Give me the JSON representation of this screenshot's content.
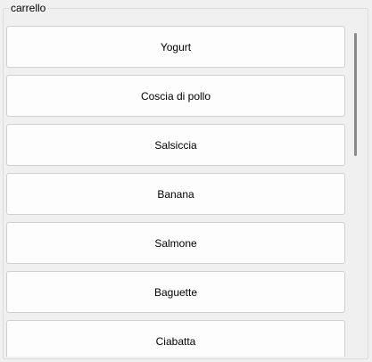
{
  "group": {
    "title": "carrello"
  },
  "items": [
    {
      "label": "Yogurt"
    },
    {
      "label": "Coscia di pollo"
    },
    {
      "label": "Salsiccia"
    },
    {
      "label": "Banana"
    },
    {
      "label": "Salmone"
    },
    {
      "label": "Baguette"
    },
    {
      "label": "Ciabatta"
    }
  ],
  "scrollbar": {
    "position_fraction": 0.0,
    "visible_fraction": 0.42
  },
  "colors": {
    "background": "#f0f0f0",
    "button_background": "#fdfdfd",
    "button_border": "#d0d0d0",
    "scroll_thumb": "#8a8a8a"
  }
}
